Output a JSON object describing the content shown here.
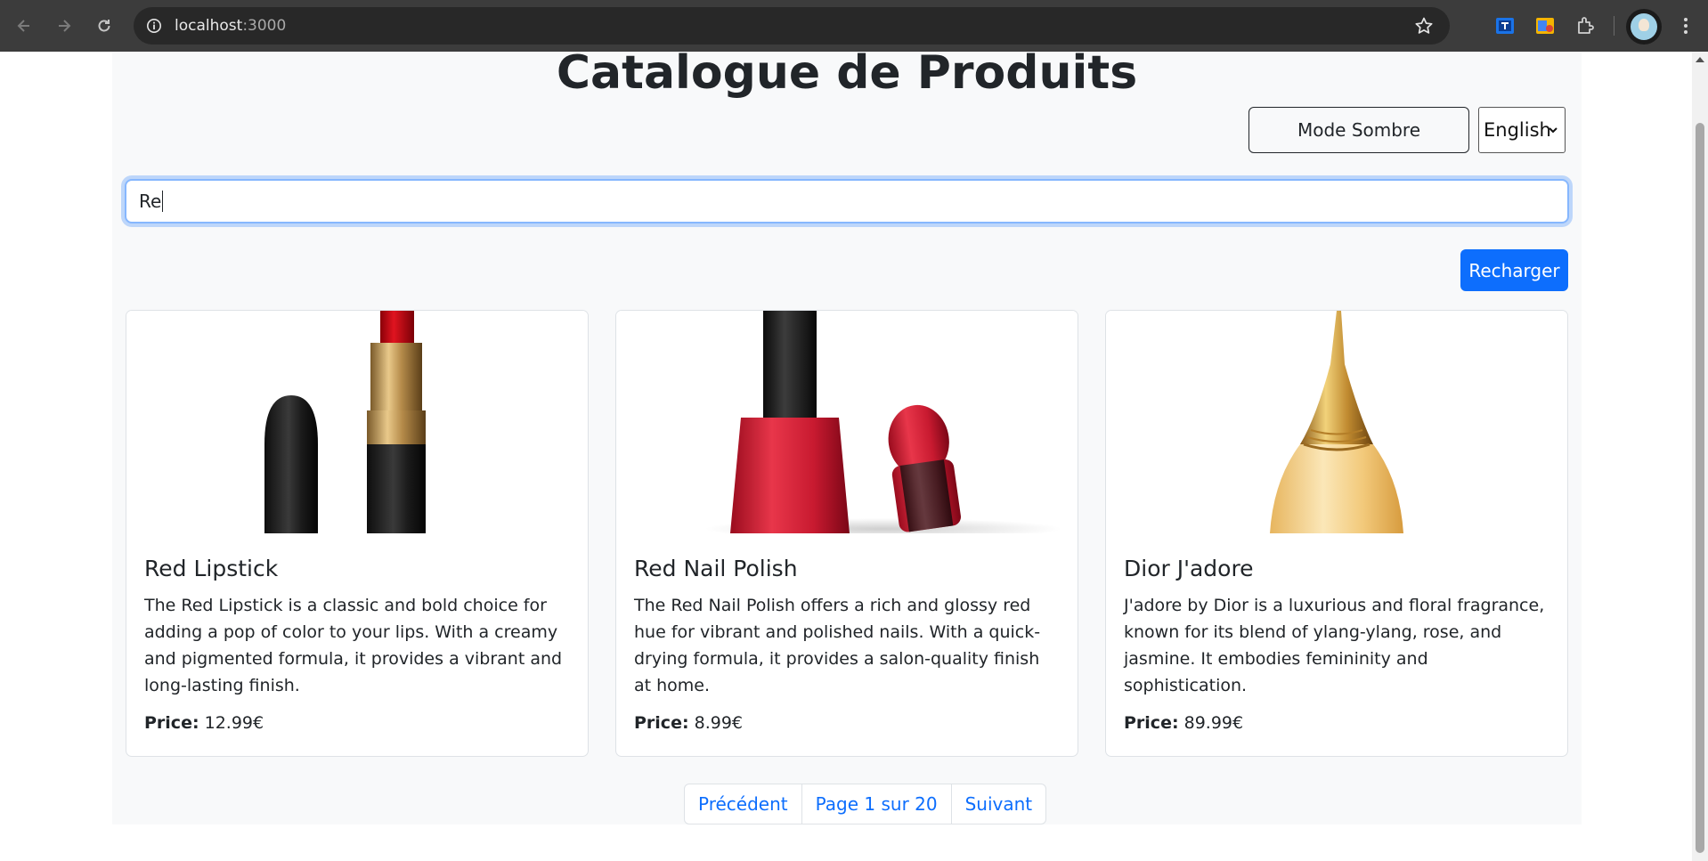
{
  "browser": {
    "url_host": "localhost",
    "url_port": ":3000"
  },
  "page": {
    "title": "Catalogue de Produits",
    "dark_mode_label": "Mode Sombre",
    "language_selected": "English",
    "search_value": "Re",
    "reload_label": "Recharger"
  },
  "products": [
    {
      "name": "Red Lipstick",
      "description": "The Red Lipstick is a classic and bold choice for adding a pop of color to your lips. With a creamy and pigmented formula, it provides a vibrant and long-lasting finish.",
      "price_label": "Price:",
      "price": "12.99€"
    },
    {
      "name": "Red Nail Polish",
      "description": "The Red Nail Polish offers a rich and glossy red hue for vibrant and polished nails. With a quick-drying formula, it provides a salon-quality finish at home.",
      "price_label": "Price:",
      "price": "8.99€"
    },
    {
      "name": "Dior J'adore",
      "description": "J'adore by Dior is a luxurious and floral fragrance, known for its blend of ylang-ylang, rose, and jasmine. It embodies femininity and sophistication.",
      "price_label": "Price:",
      "price": "89.99€"
    }
  ],
  "pagination": {
    "previous": "Précédent",
    "current": "Page 1 sur 20",
    "next": "Suivant"
  },
  "colors": {
    "primary": "#0d6efd",
    "text": "#212529",
    "container_bg": "#f8f9fa",
    "lipstick_red": "#d0101a",
    "polish_red": "#d81f33",
    "perfume_gold": "#e8b55a"
  }
}
